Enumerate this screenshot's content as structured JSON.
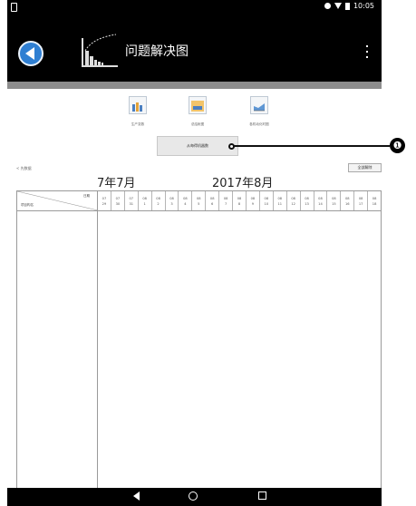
{
  "status_bar": {
    "time": "10:05"
  },
  "app_bar": {
    "title": "问题解决图"
  },
  "toolbar": {
    "items": [
      {
        "label": "生产变数"
      },
      {
        "label": "总结帐图"
      },
      {
        "label": "各机动化时图"
      }
    ]
  },
  "display_button_label": "从每得机器数",
  "back_link_label": "< 先数据",
  "all_clear_label": "全部解除",
  "months": {
    "left": "7年7月",
    "right": "2017年8月"
  },
  "grid": {
    "corner_date_label": "日期",
    "corner_item_label": "项目构名",
    "days": [
      {
        "mon": "07",
        "day": "29"
      },
      {
        "mon": "07",
        "day": "30"
      },
      {
        "mon": "07",
        "day": "31"
      },
      {
        "mon": "08",
        "day": "1"
      },
      {
        "mon": "08",
        "day": "2"
      },
      {
        "mon": "08",
        "day": "3"
      },
      {
        "mon": "08",
        "day": "4"
      },
      {
        "mon": "08",
        "day": "5"
      },
      {
        "mon": "08",
        "day": "6"
      },
      {
        "mon": "08",
        "day": "7"
      },
      {
        "mon": "08",
        "day": "8"
      },
      {
        "mon": "08",
        "day": "9"
      },
      {
        "mon": "08",
        "day": "10"
      },
      {
        "mon": "08",
        "day": "11"
      },
      {
        "mon": "08",
        "day": "12"
      },
      {
        "mon": "08",
        "day": "13"
      },
      {
        "mon": "08",
        "day": "14"
      },
      {
        "mon": "08",
        "day": "15"
      },
      {
        "mon": "08",
        "day": "16"
      },
      {
        "mon": "08",
        "day": "17"
      },
      {
        "mon": "08",
        "day": "18"
      }
    ]
  },
  "callout": {
    "number": "❶"
  },
  "colors": {
    "app_bar": "#000000",
    "back_button": "#2f7fd2",
    "band": "#8d8d8d"
  }
}
